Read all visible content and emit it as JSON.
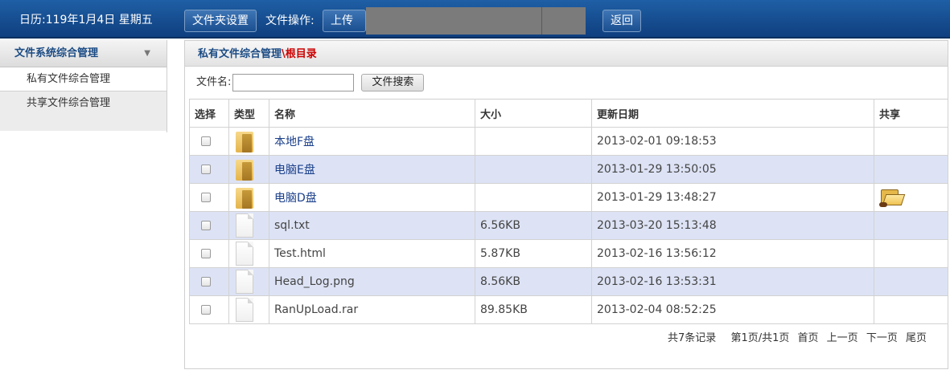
{
  "topbar": {
    "calendar": "日历:119年1月4日 星期五",
    "folder_settings_button": "文件夹设置",
    "file_ops_label": "文件操作:",
    "upload_button": "上传",
    "back_button": "返回"
  },
  "sidebar": {
    "header": "文件系统综合管理",
    "items": [
      {
        "label": "私有文件综合管理"
      },
      {
        "label": "共享文件综合管理"
      }
    ]
  },
  "main": {
    "breadcrumb_module": "私有文件综合管理",
    "breadcrumb_sep": "\\",
    "breadcrumb_root": "根目录",
    "search_label": "文件名:",
    "search_value": "",
    "search_button": "文件搜索",
    "columns": [
      "选择",
      "类型",
      "名称",
      "大小",
      "更新日期",
      "共享"
    ],
    "rows": [
      {
        "type": "folder",
        "name": "本地F盘",
        "size": "",
        "date": "2013-02-01 09:18:53",
        "shared": false,
        "checked": false
      },
      {
        "type": "folder",
        "name": "电脑E盘",
        "size": "",
        "date": "2013-01-29 13:50:05",
        "shared": false,
        "checked": false
      },
      {
        "type": "folder",
        "name": "电脑D盘",
        "size": "",
        "date": "2013-01-29 13:48:27",
        "shared": true,
        "checked": false
      },
      {
        "type": "file",
        "name": "sql.txt",
        "size": "6.56KB",
        "date": "2013-03-20 15:13:48",
        "shared": false,
        "checked": false
      },
      {
        "type": "file",
        "name": "Test.html",
        "size": "5.87KB",
        "date": "2013-02-16 13:56:12",
        "shared": false,
        "checked": false
      },
      {
        "type": "file",
        "name": "Head_Log.png",
        "size": "8.56KB",
        "date": "2013-02-16 13:53:31",
        "shared": false,
        "checked": false
      },
      {
        "type": "file",
        "name": "RanUpLoad.rar",
        "size": "89.85KB",
        "date": "2013-02-04 08:52:25",
        "shared": false,
        "checked": false
      }
    ],
    "pager": {
      "total": "共7条记录",
      "page_info": "第1页/共1页",
      "first": "首页",
      "prev": "上一页",
      "next": "下一页",
      "last": "尾页"
    }
  }
}
